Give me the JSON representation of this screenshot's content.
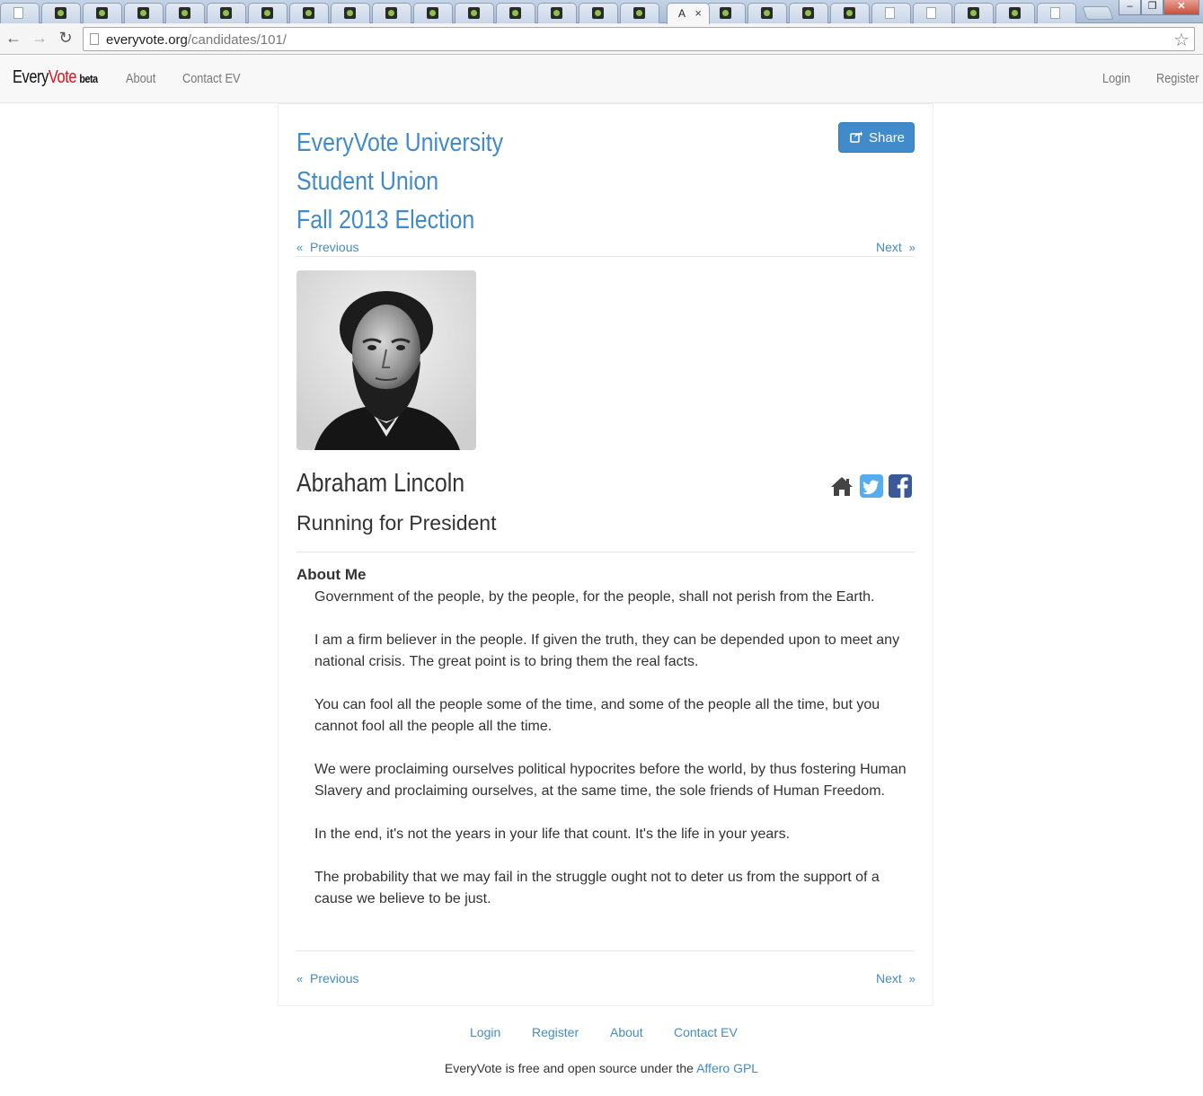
{
  "browser": {
    "active_tab_title": "A",
    "active_tab_close": "×",
    "url_host": "everyvote.org",
    "url_path": "/candidates/101/",
    "back": "←",
    "forward": "→",
    "reload": "↻",
    "bookmark_star": "☆",
    "window_minimize": "–",
    "window_restore": "❐",
    "window_close": "✕"
  },
  "site": {
    "brand_every": "Every",
    "brand_vote": "Vote",
    "brand_beta": "beta",
    "nav": {
      "about": "About",
      "contact": "Contact EV",
      "login": "Login",
      "register": "Register"
    }
  },
  "election": {
    "line1": "EveryVote University",
    "line2": "Student Union",
    "line3": "Fall 2013 Election"
  },
  "share_label": "Share",
  "pager": {
    "previous": "Previous",
    "next": "Next",
    "prev_chev": "«",
    "next_chev": "»"
  },
  "candidate": {
    "name": "Abraham Lincoln",
    "running_for": "Running for President",
    "about_heading": "About Me",
    "bio": [
      "Government of the people, by the people, for the people, shall not perish from the Earth.",
      "I am a firm believer in the people. If given the truth, they can be depended upon to meet any national crisis. The great point is to bring them the real facts.",
      "You can fool all the people some of the time, and some of the people all the time, but you cannot fool all the people all the time.",
      "We were proclaiming ourselves political hypocrites before the world, by thus fostering Human Slavery and proclaiming ourselves, at the same time, the sole friends of Human Freedom.",
      "In the end, it's not the years in your life that count. It's the life in your years.",
      "The probability that we may fail in the struggle ought not to deter us from the support of a cause we believe to be just."
    ]
  },
  "footer": {
    "links": {
      "login": "Login",
      "register": "Register",
      "about": "About",
      "contact": "Contact EV"
    },
    "note_prefix": "EveryVote is free and open source under the ",
    "license_link": "Affero GPL"
  },
  "colors": {
    "link": "#428bca",
    "brand_red": "#d9121b",
    "twitter": "#55acee",
    "facebook": "#3b5998"
  }
}
